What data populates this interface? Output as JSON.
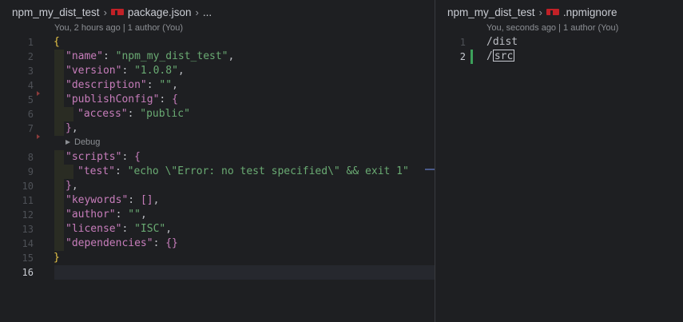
{
  "left": {
    "breadcrumb": {
      "folder": "npm_my_dist_test",
      "file": "package.json",
      "more": "..."
    },
    "blame": "You, 2 hours ago | 1 author (You)",
    "codelens": "Debug",
    "lines": [
      {
        "num": "1"
      },
      {
        "num": "2"
      },
      {
        "num": "3"
      },
      {
        "num": "4"
      },
      {
        "num": "5"
      },
      {
        "num": "6"
      },
      {
        "num": "7"
      },
      {
        "num": "8"
      },
      {
        "num": "9"
      },
      {
        "num": "10"
      },
      {
        "num": "11"
      },
      {
        "num": "12"
      },
      {
        "num": "13"
      },
      {
        "num": "14"
      },
      {
        "num": "15"
      },
      {
        "num": "16"
      }
    ],
    "code": {
      "l1_open": "{",
      "l2_key": "\"name\"",
      "l2_val": "\"npm_my_dist_test\"",
      "l3_key": "\"version\"",
      "l3_val": "\"1.0.8\"",
      "l4_key": "\"description\"",
      "l4_val": "\"\"",
      "l5_key": "\"publishConfig\"",
      "l5_open": "{",
      "l6_key": "\"access\"",
      "l6_val": "\"public\"",
      "l7_close": "}",
      "l8_key": "\"scripts\"",
      "l8_open": "{",
      "l9_key": "\"test\"",
      "l9_val": "\"echo \\\"Error: no test specified\\\" && exit 1\"",
      "l10_close": "}",
      "l11_key": "\"keywords\"",
      "l11_val": "[]",
      "l12_key": "\"author\"",
      "l12_val": "\"\"",
      "l13_key": "\"license\"",
      "l13_val": "\"ISC\"",
      "l14_key": "\"dependencies\"",
      "l14_val": "{}",
      "l15_close": "}"
    }
  },
  "right": {
    "breadcrumb": {
      "folder": "npm_my_dist_test",
      "file": ".npmignore"
    },
    "blame": "You, seconds ago | 1 author (You)",
    "lines": [
      {
        "num": "1",
        "text": "/dist"
      },
      {
        "num": "2",
        "text_prefix": "/",
        "text_cursor": "src"
      }
    ]
  },
  "colors": {
    "background": "#1e1f22",
    "key": "#c77dbb",
    "string": "#6aab73",
    "bracket_outer": "#e7c547",
    "bracket_inner": "#c77dbb",
    "bracket_deep": "#56a8f5",
    "added_line": "#3ca05a"
  }
}
